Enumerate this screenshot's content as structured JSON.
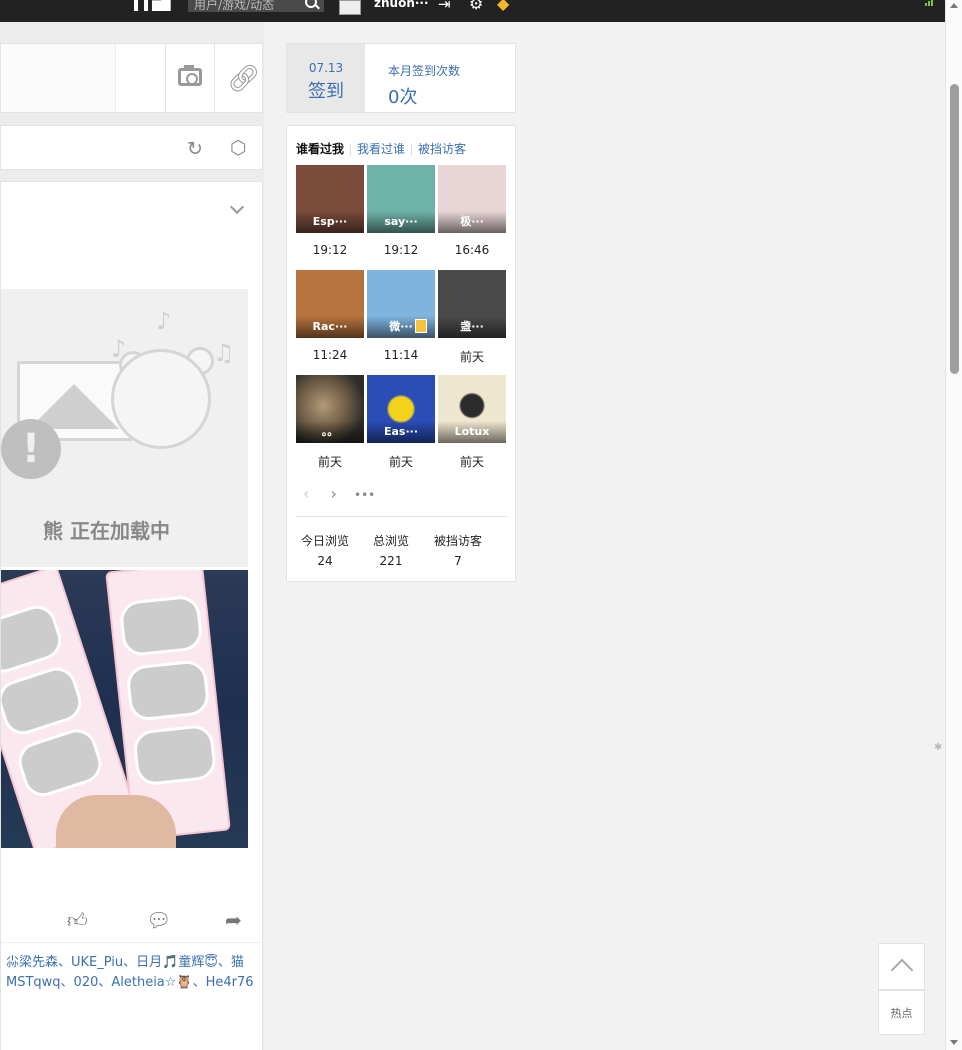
{
  "topbar": {
    "search_placeholder": "用户/游戏/动态",
    "username": "zhuoh···"
  },
  "loading": {
    "text": "熊 正在加载中"
  },
  "likes": {
    "line1": "尛梁先森、UKE_Piu、日月🎵童辉😇、猫",
    "line2": "MSTqwq、020、Aletheia☆🦉、He4r76"
  },
  "signin": {
    "date": "07.13",
    "button": "签到",
    "month_label": "本月签到次数",
    "month_count": "0次"
  },
  "visitors": {
    "tabs": [
      "谁看过我",
      "我看过谁",
      "被挡访客"
    ],
    "items": [
      {
        "name": "Esp···",
        "time": "19:12",
        "color": "#7a4a3a"
      },
      {
        "name": "say···",
        "time": "19:12",
        "color": "#6fb3a8"
      },
      {
        "name": "极···",
        "time": "16:46",
        "color": "#e8d6d6"
      },
      {
        "name": "Rac···",
        "time": "11:24",
        "color": "#b7733d"
      },
      {
        "name": "微···",
        "time": "11:14",
        "color": "#7fb4de"
      },
      {
        "name": "盏···",
        "time": "前天",
        "color": "#4a4a4a"
      },
      {
        "name": "。。",
        "time": "前天",
        "color": "#3a3a38"
      },
      {
        "name": "Eas···",
        "time": "前天",
        "color": "#2a4db8"
      },
      {
        "name": "Lotux",
        "time": "前天",
        "color": "#efe6cf"
      }
    ],
    "stats": [
      {
        "label": "今日浏览",
        "value": "24"
      },
      {
        "label": "总浏览",
        "value": "221"
      },
      {
        "label": "被挡访客",
        "value": "7"
      }
    ]
  },
  "float": {
    "hot_label": "热点"
  }
}
